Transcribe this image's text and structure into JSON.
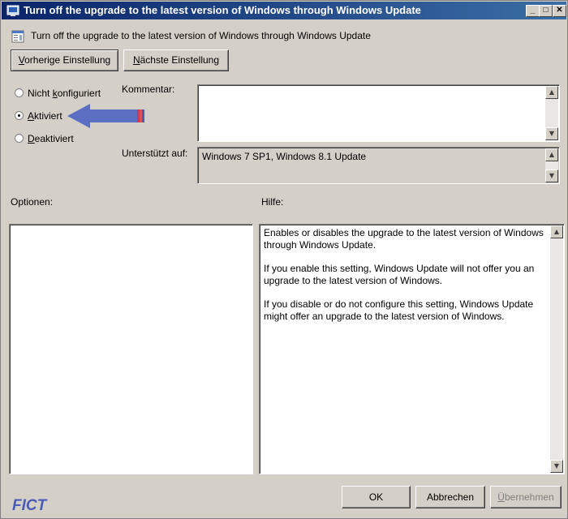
{
  "window": {
    "title": "Turn off the upgrade to the latest version of Windows through Windows Update",
    "controls": [
      "_",
      "□",
      "✕"
    ]
  },
  "header": {
    "setting_name": "Turn off the upgrade to the latest version of Windows through Windows Update"
  },
  "nav": {
    "prev_label_u": "V",
    "prev_label_rest": "orherige Einstellung",
    "next_label_u": "N",
    "next_label_rest": "ächste Einstellung"
  },
  "radios": {
    "not_configured_pre": "Nicht ",
    "not_configured_u": "k",
    "not_configured_post": "onfiguriert",
    "enabled_u": "A",
    "enabled_post": "ktiviert",
    "disabled_u": "D",
    "disabled_post": "eaktiviert",
    "selected": "Aktiviert"
  },
  "comment": {
    "label": "Kommentar:",
    "value": ""
  },
  "supported": {
    "label": "Unterstützt auf:",
    "value": "Windows 7 SP1, Windows 8.1 Update"
  },
  "options": {
    "label": "Optionen:"
  },
  "help": {
    "label": "Hilfe:",
    "paragraphs": [
      "Enables or disables the upgrade to the latest version of Windows through Windows Update.",
      "If you enable this setting, Windows Update will not offer you an upgrade to the latest version of Windows.",
      "If you disable or do not configure this setting, Windows Update might offer an upgrade to the latest version of Windows."
    ]
  },
  "footer": {
    "ok_label": "OK",
    "cancel_label": "Abbrechen",
    "apply_u": "Ü",
    "apply_rest": "bernehmen"
  },
  "watermark": {
    "text": "FICT"
  },
  "colors": {
    "arrow": "#5a6fc2",
    "title_start": "#0a246a",
    "title_end": "#3a6ea5"
  }
}
